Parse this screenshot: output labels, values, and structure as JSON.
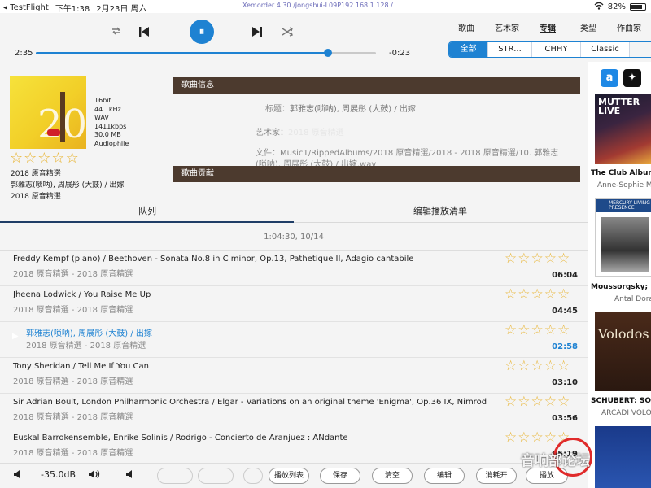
{
  "status_bar": {
    "app_name": "TestFlight",
    "time": "下午1:38",
    "date": "2月23日 周六",
    "center": "Xemorder 4.30 /Jongshui-L09P192.168.1.128 /",
    "battery": "82%",
    "battery_level": 0.82
  },
  "transport": {
    "elapsed": "2:35",
    "remaining": "-0:23",
    "progress": 0.86,
    "icons": [
      "repeat-icon",
      "previous-icon",
      "pause-icon",
      "next-icon",
      "shuffle-icon"
    ],
    "pause_glyph": "⏸"
  },
  "browse_tabs": [
    {
      "label": "歌曲",
      "active": false
    },
    {
      "label": "艺术家",
      "active": false
    },
    {
      "label": "专辑",
      "active": true
    },
    {
      "label": "类型",
      "active": false
    },
    {
      "label": "作曲家",
      "active": false
    }
  ],
  "filters": [
    {
      "label": "全部",
      "active": true
    },
    {
      "label": "STR...",
      "active": false
    },
    {
      "label": "CHHY",
      "active": false
    },
    {
      "label": "Classic",
      "active": false
    }
  ],
  "album": {
    "cover_mark": "20",
    "format": [
      "16bit",
      "44.1kHz",
      "WAV",
      "1411kbps",
      "30.0 MB",
      "Audiophile"
    ],
    "rating": 0,
    "album_name": "2018 原音精選",
    "track_artist": "郭雅志(唢呐), 周展彤 (大鼓) / 出嫁",
    "album_name_2": "2018 原音精選"
  },
  "song_info": {
    "header": "歌曲信息",
    "title_label": "标题：",
    "title_value": "郭雅志(唢呐), 周展彤 (大鼓) / 出嫁",
    "artist_label": "艺术家：",
    "artist_value": "2018 原音精選",
    "file_label": "文件：",
    "file_value": "Music1/RippedAlbums/2018 原音精選/2018 - 2018 原音精選/10. 郭雅志(唢呐), 周展彤 (大鼓) / 出嫁.wav",
    "contrib_header": "歌曲贡献"
  },
  "queue": {
    "tab_queue": "队列",
    "tab_edit": "编辑播放清单",
    "summary": "1:04:30, 10/14",
    "tracks": [
      {
        "title": "Freddy Kempf (piano) / Beethoven - Sonata No.8 in C minor, Op.13, Pathetique II, Adagio cantabile",
        "sub": "2018 原音精選 - 2018 原音精選",
        "duration": "06:04",
        "current": false
      },
      {
        "title": "Jheena Lodwick / You Raise Me Up",
        "sub": "2018 原音精選 - 2018 原音精選",
        "duration": "04:45",
        "current": false
      },
      {
        "title": "郭雅志(唢呐), 周展彤 (大鼓) / 出嫁",
        "sub": "2018 原音精選 - 2018 原音精選",
        "duration": "02:58",
        "current": true
      },
      {
        "title": "Tony Sheridan / Tell Me If You Can",
        "sub": "2018 原音精選 - 2018 原音精選",
        "duration": "03:10",
        "current": false
      },
      {
        "title": "Sir Adrian Boult, London Philharmonic Orchestra / Elgar - Variations on an original theme 'Enigma', Op.36 IX, Nimrod",
        "sub": "2018 原音精選 - 2018 原音精選",
        "duration": "03:56",
        "current": false
      },
      {
        "title": "Euskal Barrokensemble, Enrike Solinis / Rodrigo - Concierto de Aranjuez : ANdante",
        "sub": "2018 原音精選 - 2018 原音精選",
        "duration": "05:19",
        "current": false
      }
    ]
  },
  "bottom_bar": {
    "volume": "-35.0dB",
    "buttons": [
      {
        "label": "",
        "disabled": true
      },
      {
        "label": "",
        "disabled": true
      },
      {
        "label": "",
        "disabled": true
      },
      {
        "label": "播放列表",
        "disabled": false
      },
      {
        "label": "保存",
        "disabled": false
      },
      {
        "label": "清空",
        "disabled": false
      },
      {
        "label": "编辑",
        "disabled": false
      },
      {
        "label": "消耗开",
        "disabled": false
      },
      {
        "label": "播放",
        "disabled": false
      }
    ]
  },
  "right_panel": {
    "services": [
      {
        "name": "amazon-music-icon",
        "glyph": "a",
        "color": "#1e88e5"
      },
      {
        "name": "tidal-icon",
        "glyph": "✦",
        "color": "#111111"
      }
    ],
    "albums": [
      {
        "title": "The Club Album",
        "sub": "Anne-Sophie M"
      },
      {
        "title": "Moussorgsky; R",
        "sub": "Antal Dora"
      },
      {
        "title": "SCHUBERT: SON",
        "sub": "ARCADI VOLO"
      }
    ],
    "cover_texts": [
      "MUTTER LIVE",
      "MERCURY LIVING PRESENCE",
      "Volodos",
      ""
    ]
  },
  "watermark": "音响部论坛"
}
